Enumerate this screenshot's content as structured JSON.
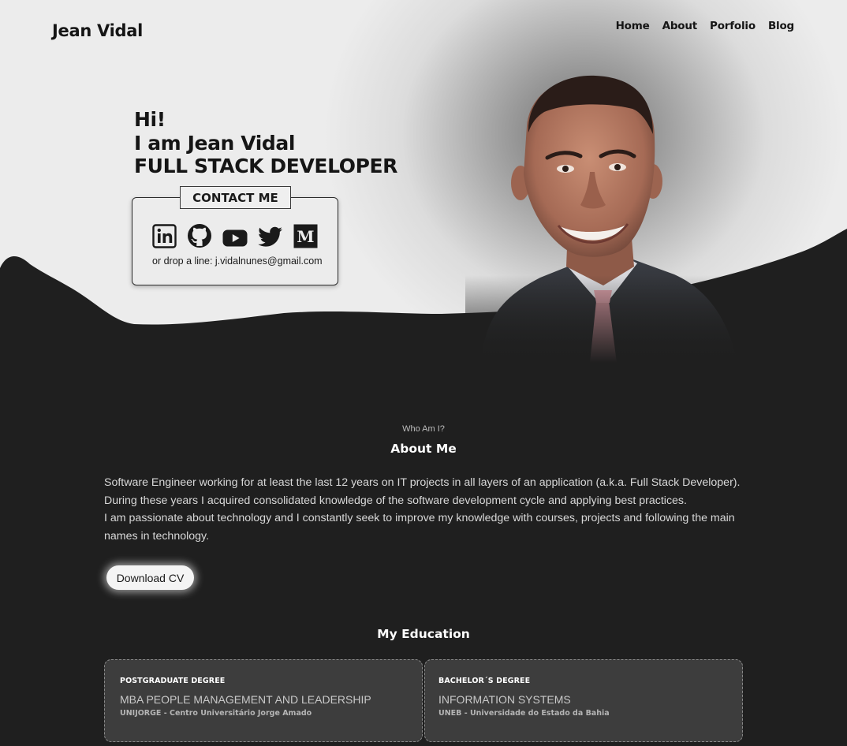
{
  "header": {
    "brand": "Jean Vidal",
    "nav": [
      {
        "label": "Home"
      },
      {
        "label": "About"
      },
      {
        "label": "Porfolio"
      },
      {
        "label": "Blog"
      }
    ]
  },
  "hero": {
    "greeting": "Hi!",
    "intro": "I am Jean Vidal",
    "role": "FULL STACK DEVELOPER",
    "contact_title": "CONTACT ME",
    "socials": [
      {
        "icon": "linkedin-icon"
      },
      {
        "icon": "github-icon"
      },
      {
        "icon": "youtube-icon"
      },
      {
        "icon": "twitter-icon"
      },
      {
        "icon": "medium-icon"
      }
    ],
    "drop_line": "or drop a line: j.vidalnunes@gmail.com"
  },
  "about": {
    "pretitle": "Who Am I?",
    "title": "About Me",
    "paragraphs": [
      "Software Engineer working for at least the last 12 years on IT projects in all layers of an application (a.k.a. Full Stack Developer).",
      "During these years I acquired consolidated knowledge of the software development cycle and applying best practices.",
      "I am passionate about technology and I constantly seek to improve my knowledge with courses, projects and following the main names in technology."
    ],
    "download_label": "Download CV"
  },
  "education": {
    "title": "My Education",
    "items": [
      {
        "kind": "POSTGRADUATE DEGREE",
        "course": "MBA PEOPLE MANAGEMENT AND LEADERSHIP",
        "school": "UNIJORGE - Centro Universitário Jorge Amado"
      },
      {
        "kind": "BACHELOR´S DEGREE",
        "course": "INFORMATION SYSTEMS",
        "school": "UNEB - Universidade do Estado da Bahia"
      }
    ]
  },
  "colors": {
    "page_background": "#1f1f1f",
    "hero_light": "#ececec",
    "card_background": "#3d3d3d",
    "text_dark": "#151515"
  }
}
